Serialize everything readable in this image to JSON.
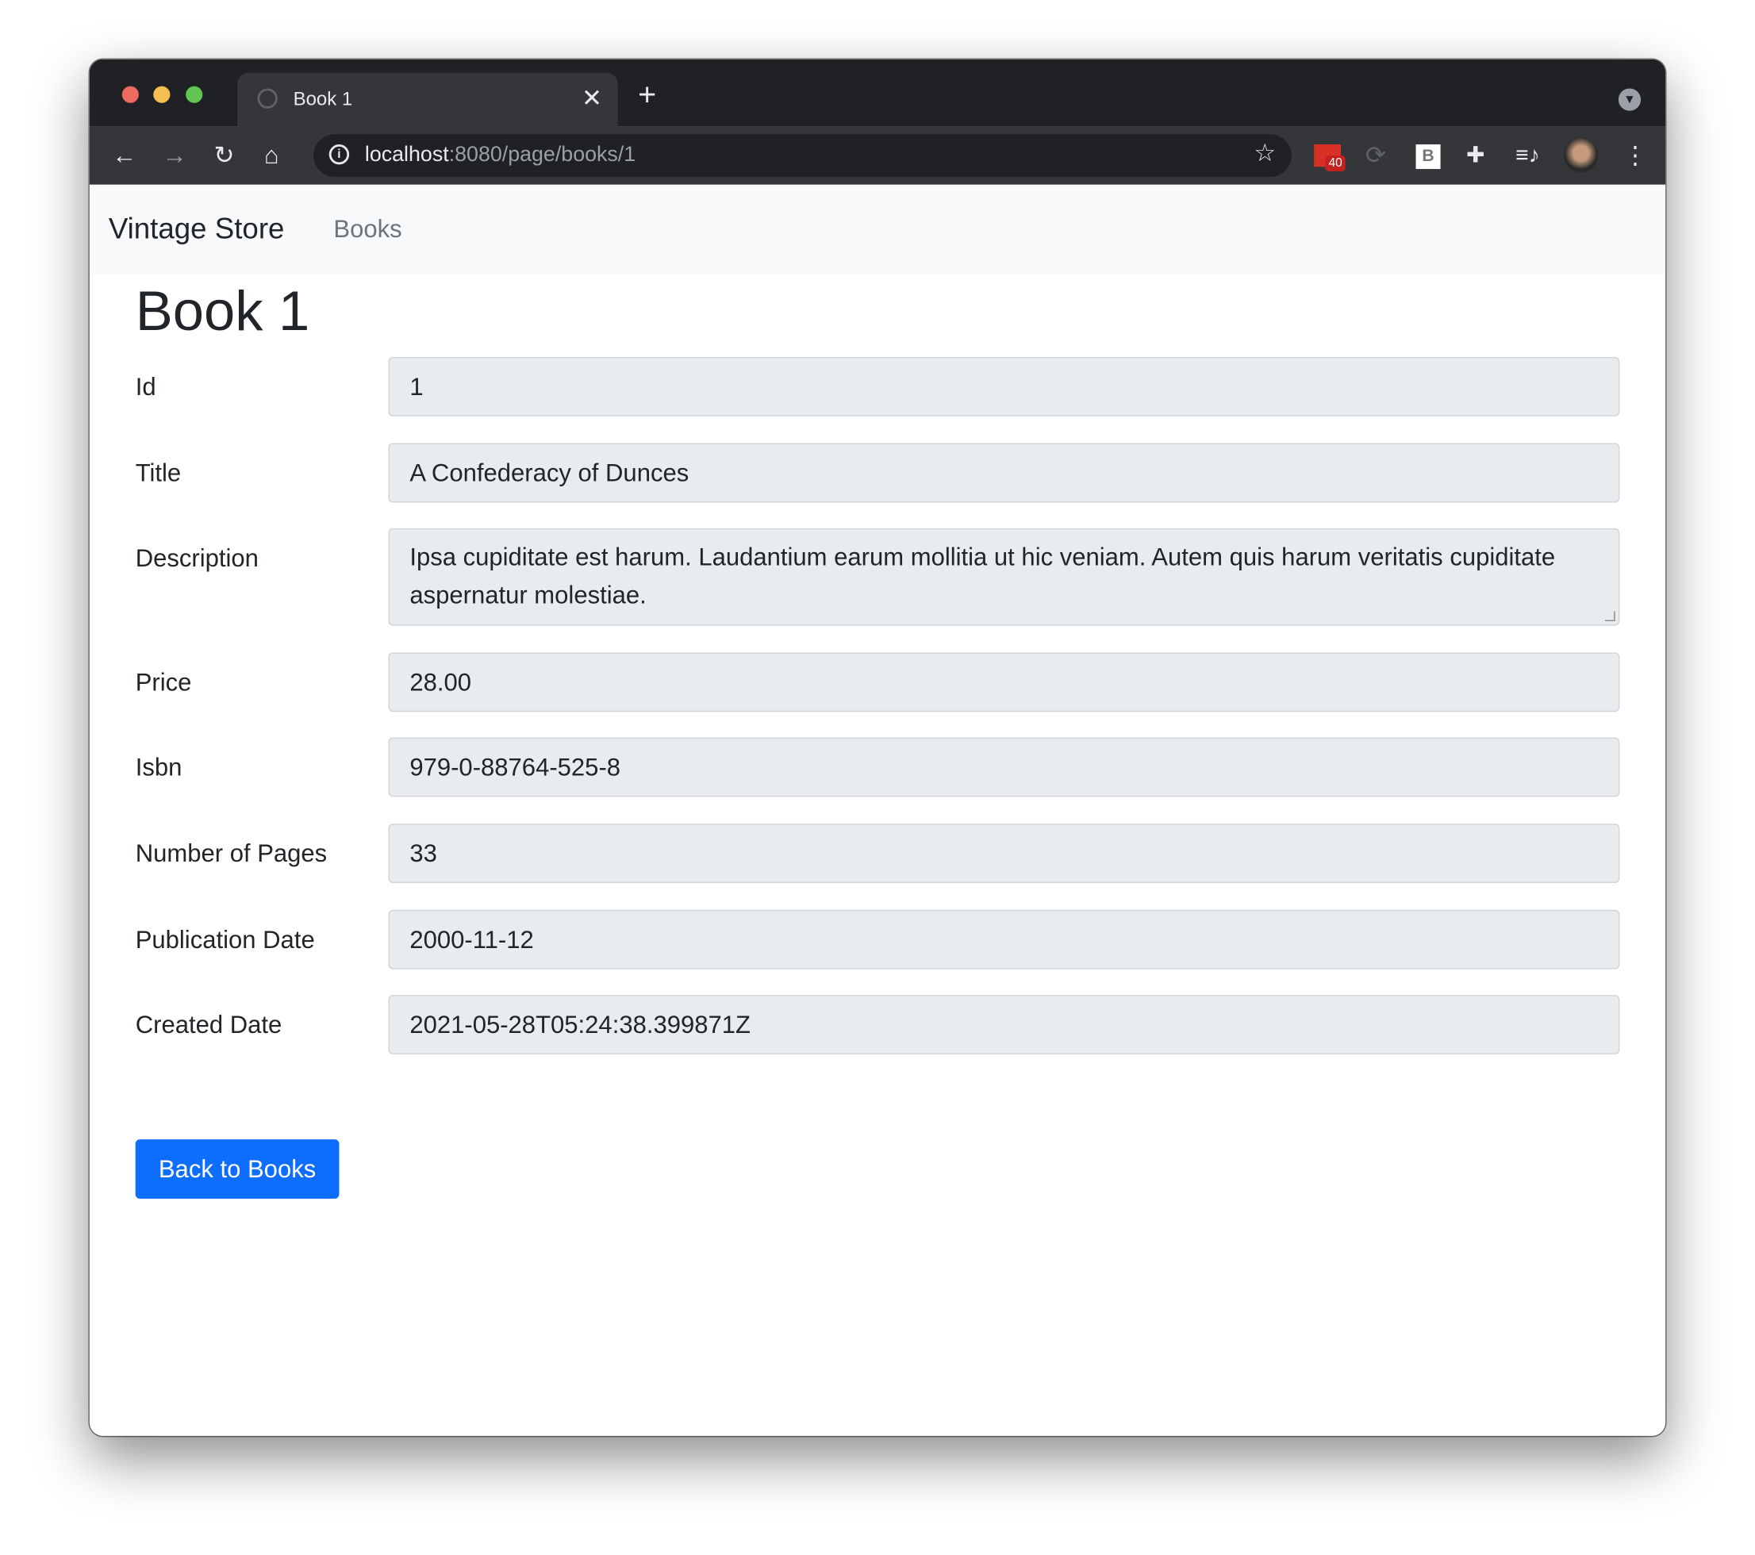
{
  "browser": {
    "tab_title": "Book 1",
    "url_host": "localhost",
    "url_rest": ":8080/page/books/1",
    "gmail_badge": "40",
    "ext_b_label": "B"
  },
  "navbar": {
    "brand": "Vintage Store",
    "links": [
      "Books"
    ]
  },
  "page": {
    "heading": "Book 1",
    "fields": [
      {
        "label": "Id",
        "value": "1"
      },
      {
        "label": "Title",
        "value": "A Confederacy of Dunces"
      },
      {
        "label": "Description",
        "value": "Ipsa cupiditate est harum. Laudantium earum mollitia ut hic veniam. Autem quis harum veritatis cupiditate aspernatur molestiae."
      },
      {
        "label": "Price",
        "value": "28.00"
      },
      {
        "label": "Isbn",
        "value": "979-0-88764-525-8"
      },
      {
        "label": "Number of Pages",
        "value": "33"
      },
      {
        "label": "Publication Date",
        "value": "2000-11-12"
      },
      {
        "label": "Created Date",
        "value": "2021-05-28T05:24:38.399871Z"
      }
    ],
    "back_button": "Back to Books"
  }
}
